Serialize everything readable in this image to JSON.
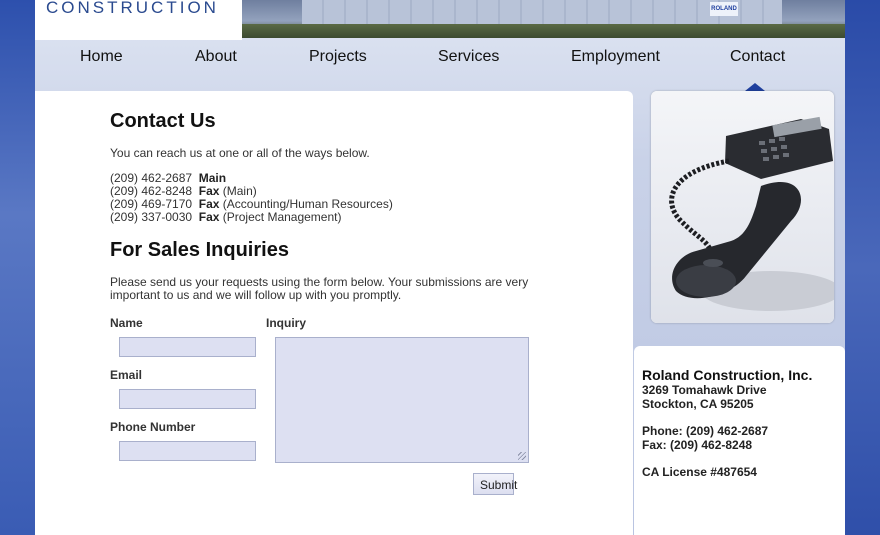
{
  "header": {
    "logo_text": "CONSTRUCTION",
    "sign_text": "ROLAND"
  },
  "nav": {
    "items": [
      {
        "label": "Home"
      },
      {
        "label": "About"
      },
      {
        "label": "Projects"
      },
      {
        "label": "Services"
      },
      {
        "label": "Employment"
      },
      {
        "label": "Contact"
      }
    ],
    "active": "Contact"
  },
  "contact": {
    "title": "Contact Us",
    "intro": "You can reach us at one or all of the ways below.",
    "phones": [
      {
        "number": "(209) 462-2687",
        "type": "Main",
        "note": ""
      },
      {
        "number": "(209) 462-8248",
        "type": "Fax",
        "note": "(Main)"
      },
      {
        "number": "(209) 469-7170",
        "type": "Fax",
        "note": "(Accounting/Human Resources)"
      },
      {
        "number": "(209) 337-0030",
        "type": "Fax",
        "note": "(Project Management)"
      }
    ]
  },
  "sales": {
    "title": "For Sales Inquiries",
    "text": "Please send us your requests using the form below. Your submissions are very important to us and we will follow up with you promptly."
  },
  "form": {
    "name_label": "Name",
    "email_label": "Email",
    "phone_label": "Phone Number",
    "inquiry_label": "Inquiry",
    "name_value": "",
    "email_value": "",
    "phone_value": "",
    "inquiry_value": "",
    "submit_label": "Submit"
  },
  "address": {
    "company": "Roland Construction, Inc.",
    "street": "3269 Tomahawk Drive",
    "city": "Stockton, CA 95205",
    "phone": "Phone: (209) 462-2687",
    "fax": "Fax: (209) 462-8248",
    "license": "CA License #487654"
  },
  "colors": {
    "accent": "#1f3f9e",
    "field_bg": "#dde0f2"
  }
}
